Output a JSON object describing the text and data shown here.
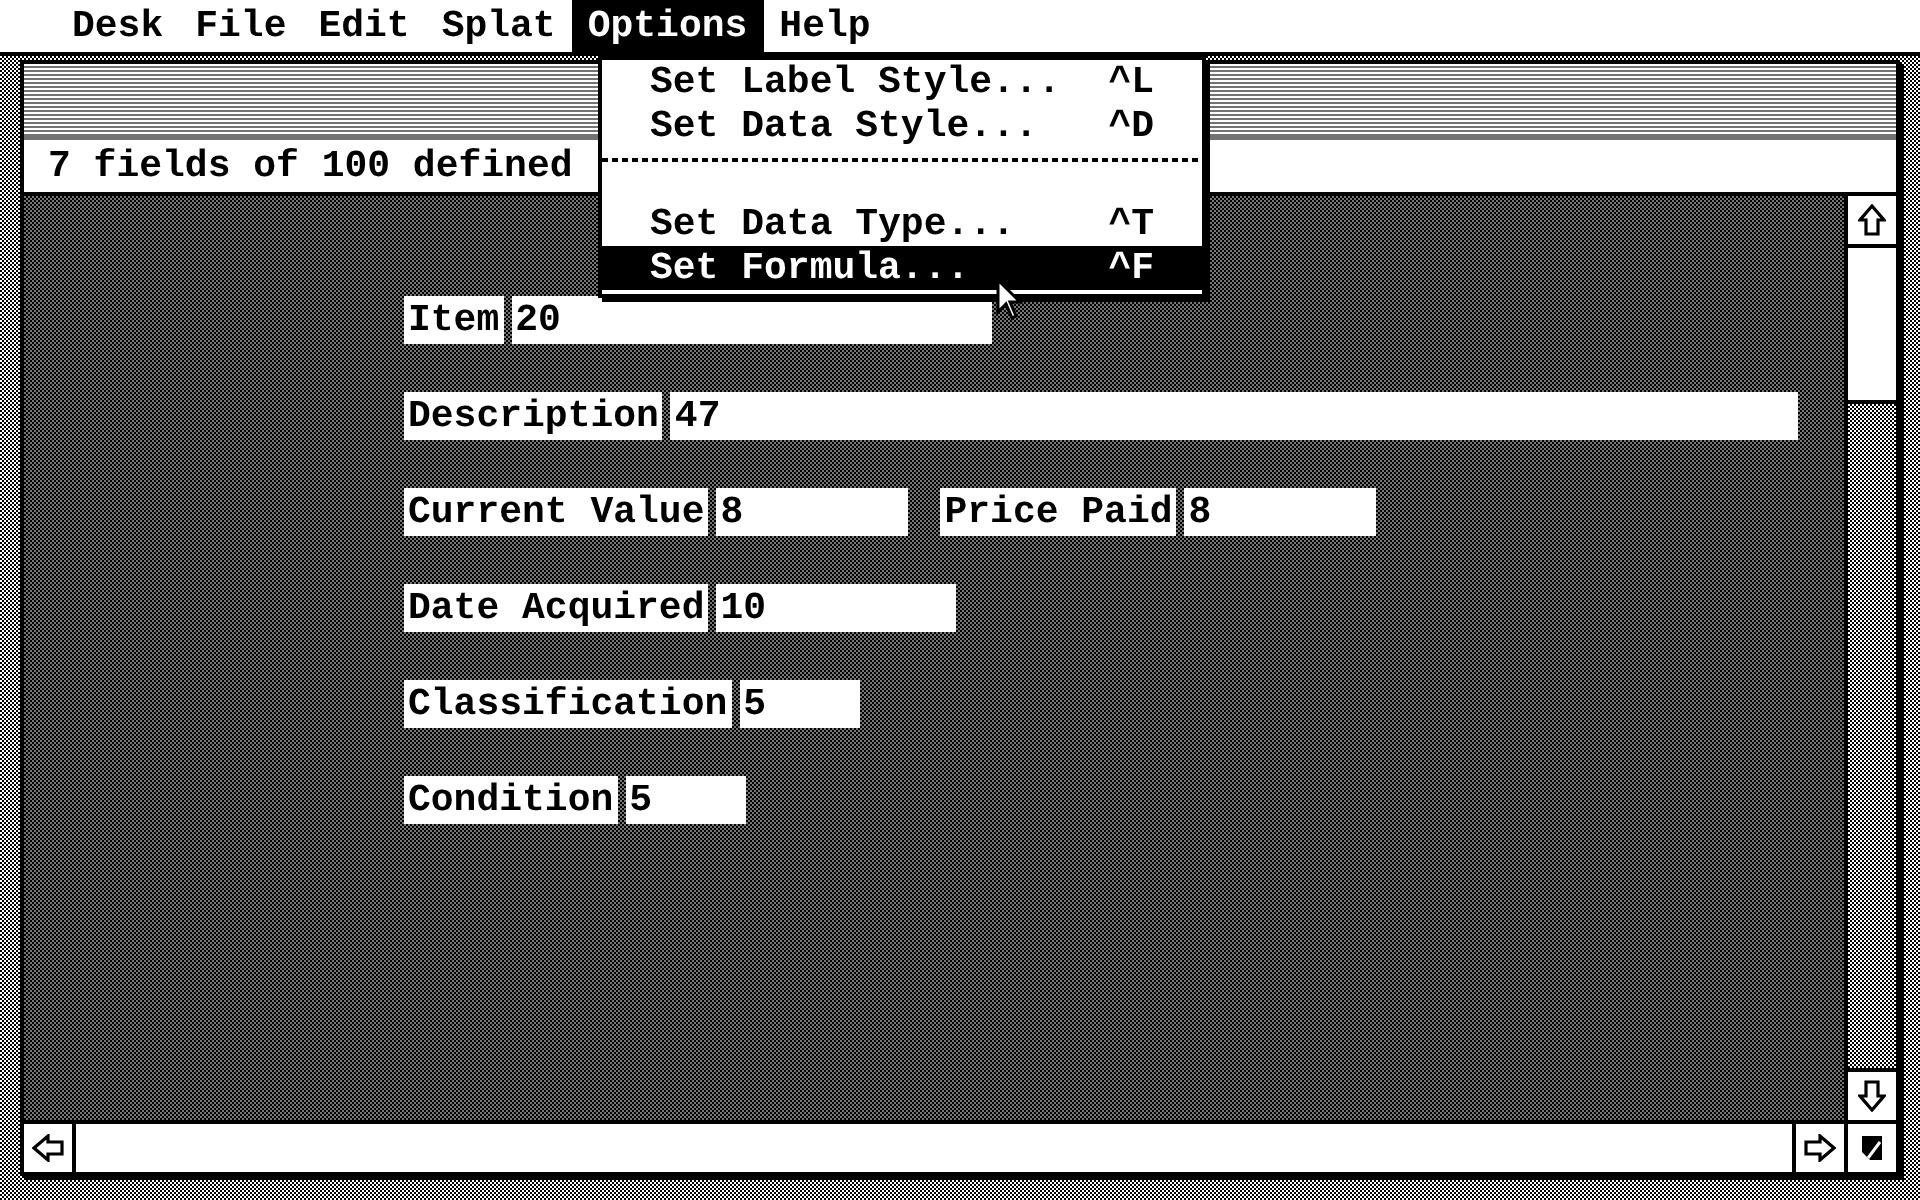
{
  "menu_bar": [
    {
      "label": "Desk",
      "selected": false
    },
    {
      "label": "File",
      "selected": false
    },
    {
      "label": "Edit",
      "selected": false
    },
    {
      "label": "Splat",
      "selected": false
    },
    {
      "label": "Options",
      "selected": true
    },
    {
      "label": "Help",
      "selected": false
    }
  ],
  "options_menu": [
    {
      "kind": "item",
      "label": "Set Label Style...",
      "shortcut": "^L",
      "selected": false
    },
    {
      "kind": "item",
      "label": "Set Data Style...",
      "shortcut": "^D",
      "selected": false
    },
    {
      "kind": "separator"
    },
    {
      "kind": "item",
      "label": "Set Data Type...",
      "shortcut": "^T",
      "selected": false
    },
    {
      "kind": "item",
      "label": "Set Formula...",
      "shortcut": "^F",
      "selected": true
    }
  ],
  "window": {
    "info_line": "7 fields of 100 defined"
  },
  "form_rows": [
    [
      {
        "label": "Item",
        "size": "20"
      }
    ],
    [
      {
        "label": "Description",
        "size": "47"
      }
    ],
    [
      {
        "label": "Current Value",
        "size": "8"
      },
      {
        "label": "Price Paid",
        "size": "8"
      }
    ],
    [
      {
        "label": "Date Acquired",
        "size": "10"
      }
    ],
    [
      {
        "label": "Classification",
        "size": "5"
      }
    ],
    [
      {
        "label": "Condition",
        "size": "5"
      }
    ]
  ]
}
